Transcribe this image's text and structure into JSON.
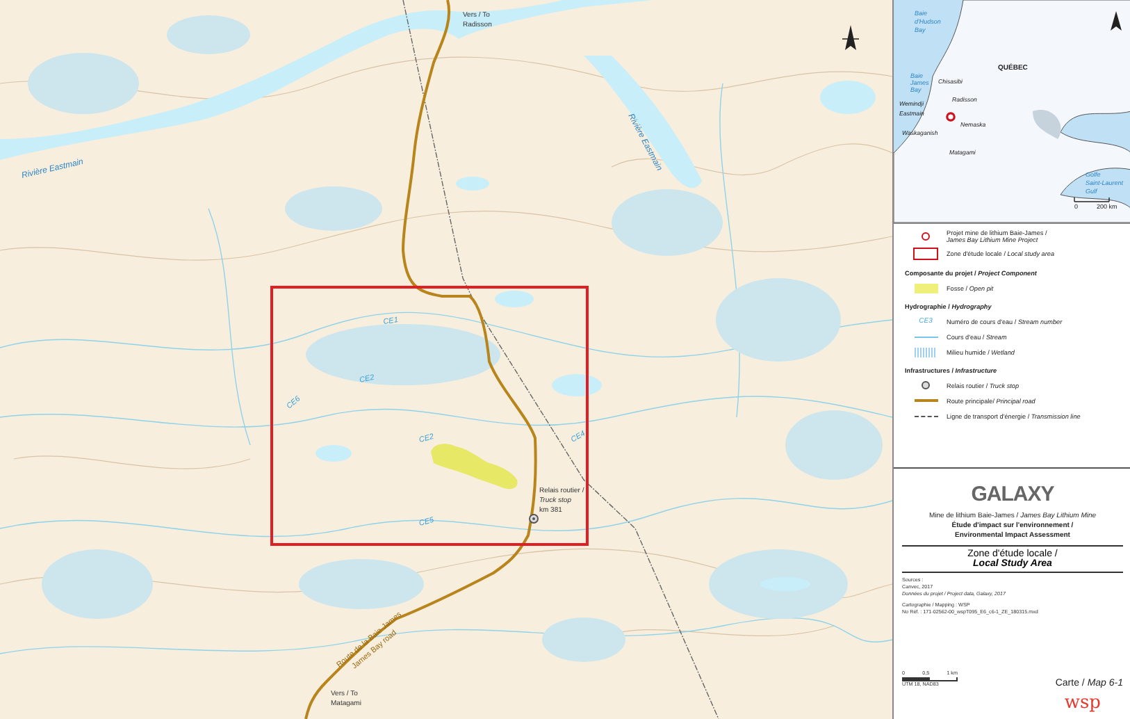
{
  "map": {
    "labels": [
      {
        "kind": "place",
        "text": "Vers / To"
      },
      {
        "kind": "place",
        "text": "Radisson"
      },
      {
        "kind": "river",
        "text": "Rivière Eastmain"
      },
      {
        "kind": "river",
        "text": "Rivière Eastmain"
      },
      {
        "kind": "stream",
        "text": "CE1"
      },
      {
        "kind": "stream",
        "text": "CE2"
      },
      {
        "kind": "stream",
        "text": "CE6"
      },
      {
        "kind": "stream",
        "text": "CE2"
      },
      {
        "kind": "stream",
        "text": "CE4"
      },
      {
        "kind": "stream",
        "text": "CE5"
      },
      {
        "kind": "place",
        "text": "Relais routier /"
      },
      {
        "kind": "place-italic",
        "text": "Truck stop"
      },
      {
        "kind": "place",
        "text": "km 381"
      },
      {
        "kind": "road",
        "text": "Route de la Baie-James"
      },
      {
        "kind": "road",
        "text": "James Bay road"
      },
      {
        "kind": "place",
        "text": "Vers / To"
      },
      {
        "kind": "place",
        "text": "Matagami"
      }
    ]
  },
  "inset": {
    "labels": [
      {
        "kind": "water",
        "text": "Baie"
      },
      {
        "kind": "water",
        "text": "d'Hudson"
      },
      {
        "kind": "water",
        "text": "Bay"
      },
      {
        "kind": "region",
        "text": "QUÉBEC"
      },
      {
        "kind": "water",
        "text": "Baie"
      },
      {
        "kind": "water",
        "text": "James"
      },
      {
        "kind": "water",
        "text": "Bay"
      },
      {
        "kind": "town",
        "text": "Chisasibi"
      },
      {
        "kind": "town",
        "text": "Wemindji"
      },
      {
        "kind": "town",
        "text": "Radisson"
      },
      {
        "kind": "town",
        "text": "Eastmain"
      },
      {
        "kind": "town",
        "text": "Nemaska"
      },
      {
        "kind": "town",
        "text": "Waskaganish"
      },
      {
        "kind": "town",
        "text": "Matagami"
      },
      {
        "kind": "water",
        "text": "Golfe"
      },
      {
        "kind": "water",
        "text": "Saint-Laurent"
      },
      {
        "kind": "water",
        "text": "Gulf"
      },
      {
        "kind": "scale",
        "text": "0"
      },
      {
        "kind": "scale",
        "text": "200 km"
      }
    ]
  },
  "legend": {
    "items": [
      {
        "kind": "project",
        "label": "Projet mine de lithium Baie-James /",
        "label2": "*James Bay Lithium Mine Project*"
      },
      {
        "kind": "study-area",
        "label": "Zone d'étude locale / *Local study area*"
      },
      {
        "kind": "heading",
        "label": "Composante du projet / *Project Component*"
      },
      {
        "kind": "pit",
        "label": "Fosse / *Open pit*"
      },
      {
        "kind": "heading",
        "label": "Hydrographie / *Hydrography*"
      },
      {
        "kind": "stream-number",
        "symbol": "CE3",
        "label": "Numéro de cours d'eau / *Stream number*"
      },
      {
        "kind": "stream",
        "label": "Cours d'eau / *Stream*"
      },
      {
        "kind": "wetland",
        "label": "Milieu humide / *Wetland*"
      },
      {
        "kind": "heading",
        "label": "Infrastructures / *Infrastructure*"
      },
      {
        "kind": "truck-stop",
        "label": "Relais routier / *Truck stop*"
      },
      {
        "kind": "road",
        "label": "Route principale/ *Principal road*"
      },
      {
        "kind": "powerline",
        "label": "Ligne de transport d'énergie / *Transmission line*"
      }
    ]
  },
  "title_block": {
    "logo": "GALAXY",
    "subtitle": [
      "Mine de lithium Baie-James / *James Bay Lithium Mine*",
      "Étude d'impact sur l'environnement /",
      "Environmental Impact Assessment"
    ],
    "title": "Zone d'étude locale /",
    "title2": "Local Study Area",
    "sources": [
      "Sources :",
      "Canvec, 2017",
      "Données du projet / Project data, Galaxy, 2017"
    ],
    "credits": [
      "Cartographie / Mapping : WSP",
      "No Réf. : 171-02562-00_wspT095_E6_c6-1_ZE_180315.mxd"
    ],
    "scale": [
      "0",
      "0,5",
      "1 km"
    ],
    "projection": "UTM 18, NAD83",
    "map_number": "Carte / *Map 6-1*",
    "company": "wsp"
  }
}
